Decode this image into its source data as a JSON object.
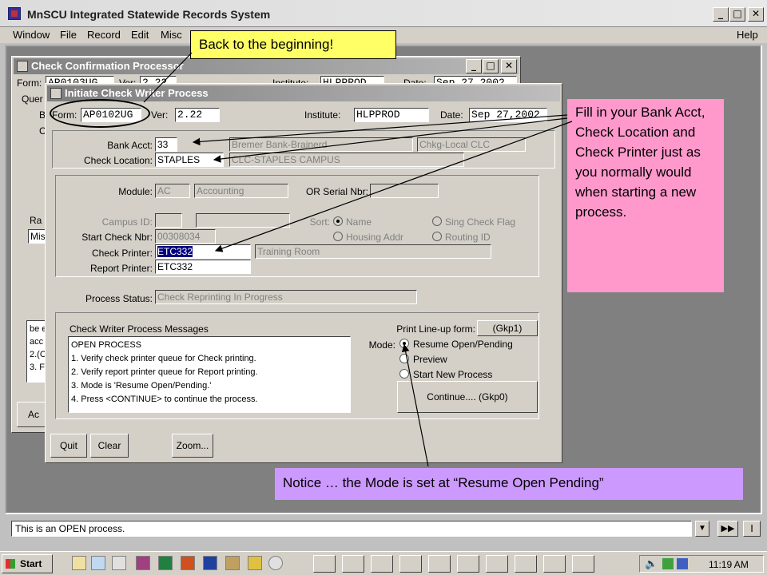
{
  "app": {
    "title": "MnSCU Integrated Statewide Records System",
    "menus": [
      "Window",
      "File",
      "Record",
      "Edit",
      "Misc"
    ],
    "help": "Help"
  },
  "bg_window": {
    "title": "Check Confirmation Processor",
    "form_label": "Form:",
    "form_value": "AP0103UG",
    "ver_label": "Ver:",
    "ver_value": "2.22",
    "inst_label": "Institute:",
    "inst_value": "HLPPROD",
    "date_label": "Date:",
    "date_value": "Sep 27,2002",
    "side_frag_1": "Quer",
    "side_frag_2": "B",
    "side_frag_3": "C",
    "side_frag_ra": "Ra",
    "side_frag_mis": "Mis",
    "msg_frag": [
      "be e",
      "acc",
      "2.(C",
      "3. F"
    ],
    "btn_frag": "Ac"
  },
  "window": {
    "title": "Initiate Check Writer Process",
    "form_label": "Form:",
    "form_value": "AP0102UG",
    "ver_label": "Ver:",
    "ver_value": "2.22",
    "inst_label": "Institute:",
    "inst_value": "HLPPROD",
    "date_label": "Date:",
    "date_value": "Sep 27,2002",
    "bank_acct_label": "Bank Acct:",
    "bank_acct_value": "33",
    "bank_name": "Bremer Bank-Brainerd",
    "bank_type": "Chkg-Local CLC",
    "check_location_label": "Check Location:",
    "check_location_value": "STAPLES",
    "check_location_name": "CLC-STAPLES CAMPUS",
    "module_label": "Module:",
    "module_value": "AC",
    "module_name": "Accounting",
    "or_serial_label": "OR Serial Nbr:",
    "or_serial_value": "",
    "campus_id_label": "Campus ID:",
    "sort_label": "Sort:",
    "sort_options": [
      "Name",
      "Housing Addr",
      "Sing Check Flag",
      "Routing ID"
    ],
    "start_check_label": "Start Check Nbr:",
    "start_check_value": "00308034",
    "check_printer_label": "Check Printer:",
    "check_printer_value": "ETC332",
    "check_printer_name": "Training Room",
    "report_printer_label": "Report Printer:",
    "report_printer_value": "ETC332",
    "process_status_label": "Process Status:",
    "process_status_value": "Check Reprinting In Progress",
    "messages_label": "Check Writer Process Messages",
    "messages": [
      "OPEN PROCESS",
      "1. Verify check printer queue for Check printing.",
      "2. Verify report printer queue for Report printing.",
      "3. Mode is 'Resume Open/Pending.'",
      "4. Press <CONTINUE> to continue the process."
    ],
    "print_lineup_label": "Print Line-up form:",
    "print_lineup_button": "(Gkp1)",
    "mode_label": "Mode:",
    "mode_options": [
      "Resume Open/Pending",
      "Preview",
      "Start New Process"
    ],
    "continue_button": "Continue.... (Gkp0)",
    "quit_button": "Quit",
    "clear_button": "Clear",
    "zoom_button": "Zoom..."
  },
  "callouts": {
    "back": "Back to the beginning!",
    "fill_in": "Fill in your Bank Acct, Check Location and Check Printer just as you normally would when starting a new process.",
    "notice": "Notice … the Mode is set at “Resume Open Pending”"
  },
  "status_bar": "This is an OPEN process.",
  "taskbar": {
    "start": "Start",
    "clock": "11:19 AM"
  },
  "colors": {
    "callout_yellow": "#ffff66",
    "callout_pink": "#ff99cc",
    "callout_lavender": "#cc99ff"
  }
}
